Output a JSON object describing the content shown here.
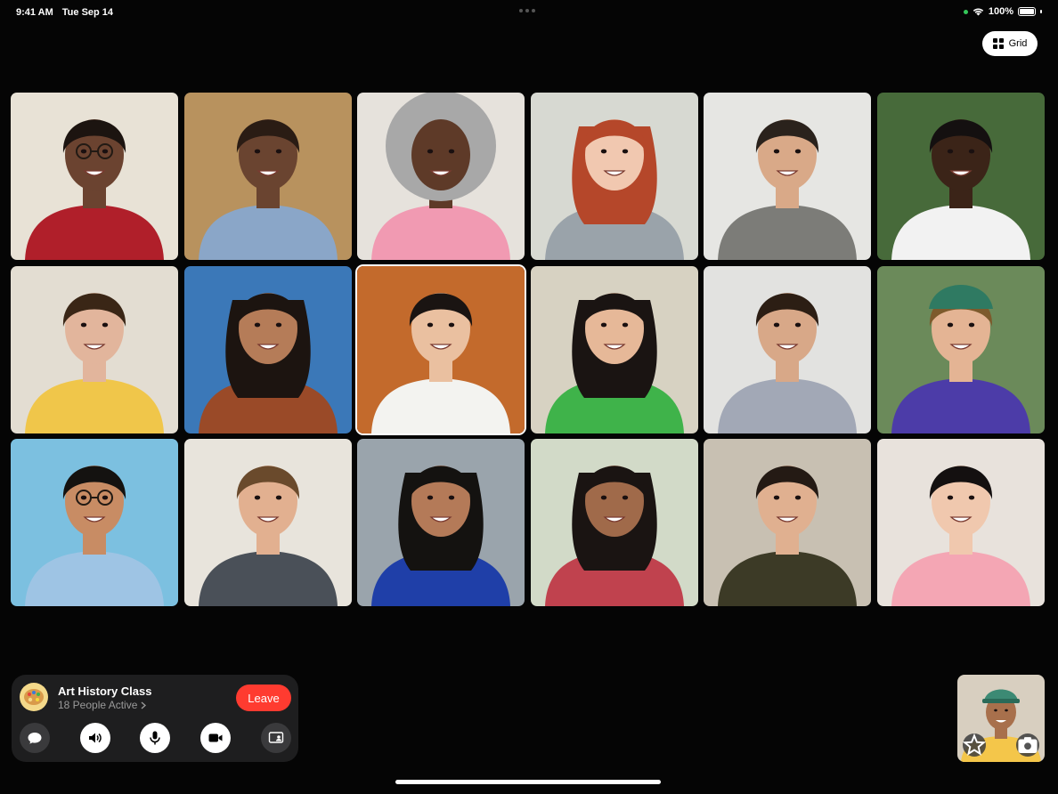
{
  "status_bar": {
    "time": "9:41 AM",
    "date": "Tue Sep 14",
    "battery": "100%"
  },
  "grid_button": {
    "label": "Grid",
    "icon": "grid-icon"
  },
  "call": {
    "title": "Art History Class",
    "people_active": "18 People Active",
    "leave_label": "Leave"
  },
  "controls": [
    {
      "name": "messages-button",
      "icon": "message-bubble-icon",
      "style": "dark"
    },
    {
      "name": "speaker-button",
      "icon": "speaker-icon",
      "style": "light"
    },
    {
      "name": "mute-button",
      "icon": "microphone-icon",
      "style": "light"
    },
    {
      "name": "camera-button",
      "icon": "video-camera-icon",
      "style": "light"
    },
    {
      "name": "shareplay-button",
      "icon": "screen-share-icon",
      "style": "dark"
    }
  ],
  "participants": [
    {
      "bg": "#e8e2d6",
      "skin": "#6b4330",
      "hair": "#1c1410",
      "shirt": "#b01f2a",
      "glasses": true
    },
    {
      "bg": "#b8925e",
      "skin": "#6a4430",
      "hair": "#2a1c14",
      "shirt": "#8aa6c8"
    },
    {
      "bg": "#e6e2dc",
      "skin": "#5e3a28",
      "hair": "#a8a8a8",
      "shirt": "#f19ab2",
      "bighair": true
    },
    {
      "bg": "#d7d9d2",
      "skin": "#f1c8b0",
      "hair": "#b5472a",
      "shirt": "#9aa3aa",
      "longhair": true
    },
    {
      "bg": "#e6e6e3",
      "skin": "#d9a988",
      "hair": "#2a221c",
      "shirt": "#7c7c78"
    },
    {
      "bg": "#476a3a",
      "skin": "#3b2418",
      "hair": "#141010",
      "shirt": "#f2f2f2"
    },
    {
      "bg": "#e3ddd2",
      "skin": "#e2b59c",
      "hair": "#3a2616",
      "shirt": "#f0c64a"
    },
    {
      "bg": "#3b78b8",
      "skin": "#b57c58",
      "hair": "#1c1410",
      "shirt": "#9a4a28",
      "longhair": true
    },
    {
      "bg": "#c36a2c",
      "skin": "#eac0a0",
      "hair": "#1a1412",
      "shirt": "#f3f3f0",
      "active": true
    },
    {
      "bg": "#d7d2c2",
      "skin": "#e6b898",
      "hair": "#1a1412",
      "shirt": "#3fb34a",
      "longhair": true
    },
    {
      "bg": "#e2e2e0",
      "skin": "#d8a888",
      "hair": "#2c1e14",
      "shirt": "#a2a8b6"
    },
    {
      "bg": "#6b8a5a",
      "skin": "#e4b494",
      "hair": "#7d5a2c",
      "shirt": "#4c3ca8",
      "cap": true
    },
    {
      "bg": "#7cc0e0",
      "skin": "#c88c64",
      "hair": "#141210",
      "shirt": "#9ec4e4",
      "glasses": true
    },
    {
      "bg": "#e8e4dc",
      "skin": "#e2b090",
      "hair": "#6a4a2c",
      "shirt": "#4a5058"
    },
    {
      "bg": "#9aa4ac",
      "skin": "#b47a58",
      "hair": "#141210",
      "shirt": "#1f3fa8",
      "longhair": true
    },
    {
      "bg": "#d2dac8",
      "skin": "#a06a4a",
      "hair": "#1a1412",
      "shirt": "#c0424e",
      "longhair": true
    },
    {
      "bg": "#c8c0b2",
      "skin": "#e0b090",
      "hair": "#241a14",
      "shirt": "#3c3a26"
    },
    {
      "bg": "#e8e2dc",
      "skin": "#f0c8ae",
      "hair": "#141010",
      "shirt": "#f4a6b4"
    }
  ],
  "self_view": {
    "bg": "#d8cfc0",
    "skin": "#a8704c",
    "hair": "#1a1410",
    "shirt": "#f4c64a",
    "cap_color": "#3c8a74"
  }
}
